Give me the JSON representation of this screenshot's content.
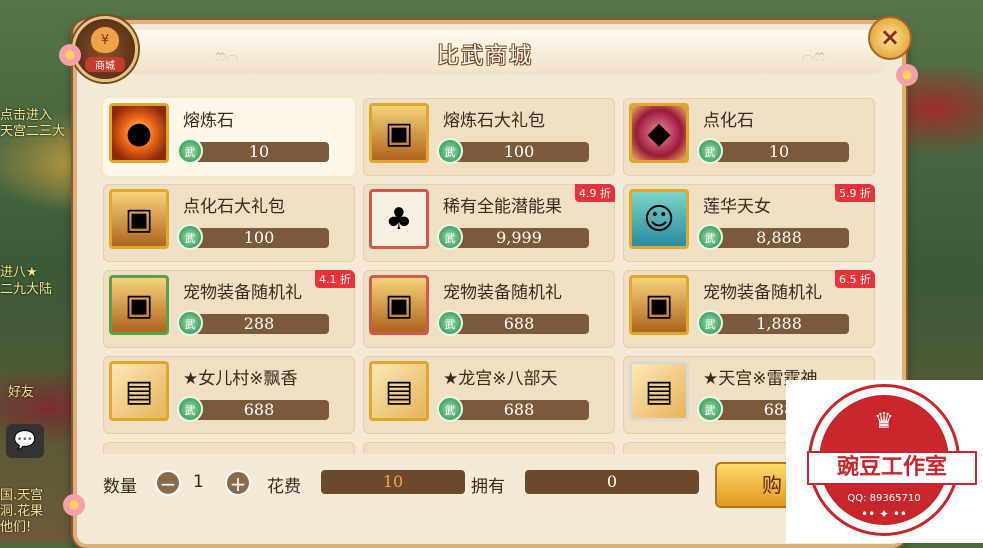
{
  "background": {
    "left_texts": [
      "点击进入",
      "天宫二三大",
      "进八★",
      "二九大陆",
      "好友",
      "国.天宫",
      "洞.花果",
      "他们!"
    ]
  },
  "window": {
    "title": "比武商城",
    "badge_label": "商城",
    "badge_icon": "¥",
    "close_icon": "×"
  },
  "items": [
    {
      "name": "熔炼石",
      "price": "10",
      "icon": "fire-stone-icon",
      "discount": "",
      "selected": true
    },
    {
      "name": "熔炼石大礼包",
      "price": "100",
      "icon": "treasure-chest-icon",
      "discount": ""
    },
    {
      "name": "点化石",
      "price": "10",
      "icon": "gem-icon",
      "discount": ""
    },
    {
      "name": "点化石大礼包",
      "price": "100",
      "icon": "treasure-chest-icon",
      "discount": ""
    },
    {
      "name": "稀有全能潜能果",
      "price": "9,999",
      "icon": "seed-icon",
      "discount": "4.9 折"
    },
    {
      "name": "莲华天女",
      "price": "8,888",
      "icon": "girl-avatar-icon",
      "discount": "5.9 折"
    },
    {
      "name": "宠物装备随机礼",
      "price": "288",
      "icon": "treasure-chest-icon",
      "discount": "4.1 折"
    },
    {
      "name": "宠物装备随机礼",
      "price": "688",
      "icon": "treasure-chest-icon",
      "discount": ""
    },
    {
      "name": "宠物装备随机礼",
      "price": "1,888",
      "icon": "treasure-chest-icon",
      "discount": "6.5 折"
    },
    {
      "name": "★女儿村※飘香",
      "price": "688",
      "icon": "ticket-icon",
      "discount": ""
    },
    {
      "name": "★龙宫※八部天",
      "price": "688",
      "icon": "ticket-icon",
      "discount": ""
    },
    {
      "name": "★天宫※雷霆神",
      "price": "688",
      "icon": "ticket-icon",
      "discount": ""
    }
  ],
  "currency_label": "武",
  "bottom": {
    "qty_label": "数量",
    "minus": "−",
    "qty_value": "1",
    "plus": "+",
    "cost_label": "花费",
    "cost_value": "10",
    "own_label": "拥有",
    "own_value": "0",
    "buy_label": "购"
  },
  "watermark": {
    "crown": "♛",
    "brand": "豌豆工作室",
    "qq": "QQ: 89365710",
    "foot": "•• ✦ ••"
  }
}
